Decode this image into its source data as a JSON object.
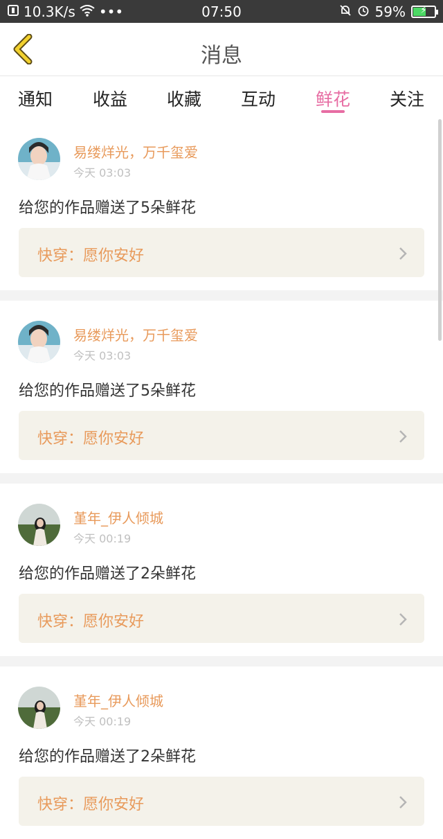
{
  "status_bar": {
    "speed": "10.3K/s",
    "dots": "•••",
    "time": "07:50",
    "battery_text": "59%",
    "battery_level": 0.59
  },
  "header": {
    "title": "消息"
  },
  "tabs": [
    {
      "label": "通知"
    },
    {
      "label": "收益"
    },
    {
      "label": "收藏"
    },
    {
      "label": "互动"
    },
    {
      "label": "鲜花",
      "active": true
    },
    {
      "label": "关注"
    }
  ],
  "feed": [
    {
      "user": "易缕烊光，万千玺爱",
      "time": "今天 03:03",
      "message": "给您的作品赠送了5朵鲜花",
      "work": "快穿：愿你安好"
    },
    {
      "user": "易缕烊光，万千玺爱",
      "time": "今天 03:03",
      "message": "给您的作品赠送了5朵鲜花",
      "work": "快穿：愿你安好"
    },
    {
      "user": "堇年_伊人倾城",
      "time": "今天 00:19",
      "message": "给您的作品赠送了2朵鲜花",
      "work": "快穿：愿你安好"
    },
    {
      "user": "堇年_伊人倾城",
      "time": "今天 00:19",
      "message": "给您的作品赠送了2朵鲜花",
      "work": "快穿：愿你安好"
    }
  ],
  "colors": {
    "accent": "#e76da3",
    "name": "#e89a5b",
    "link_bg": "#f4f2ea"
  }
}
